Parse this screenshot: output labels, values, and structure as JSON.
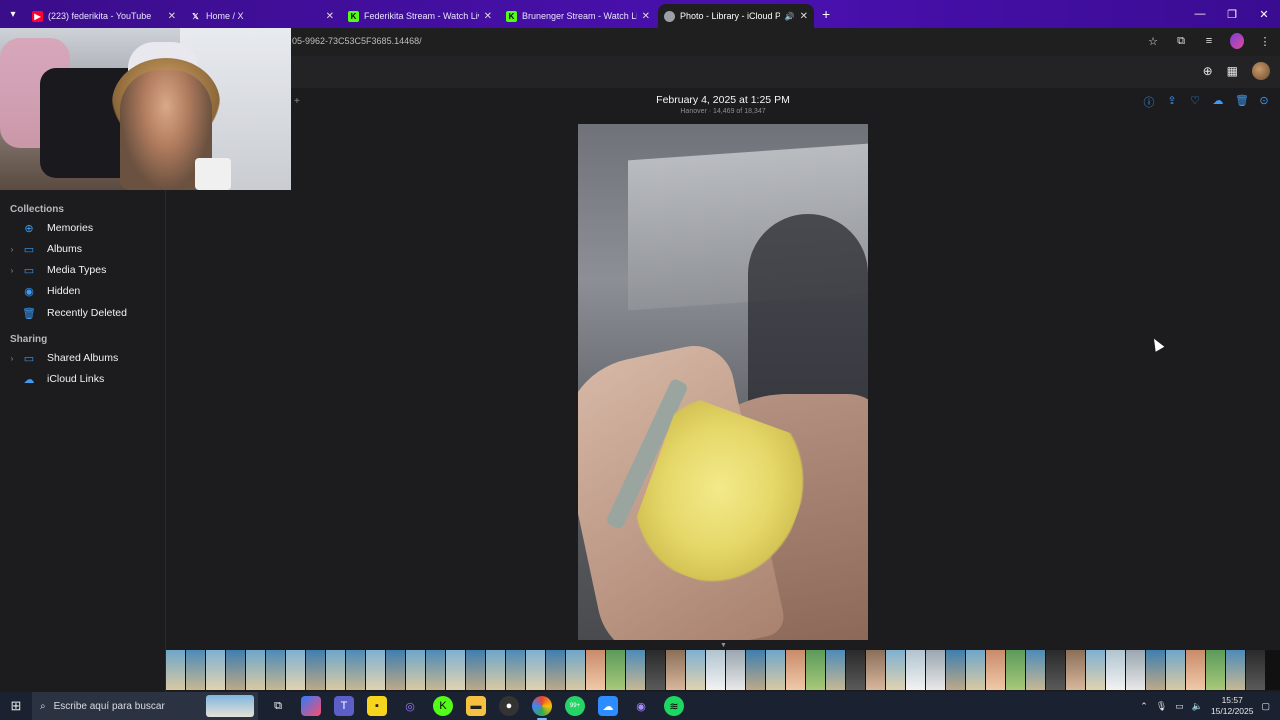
{
  "browser": {
    "tabs": [
      {
        "title": "(223) federikita - YouTube",
        "favicon": "youtube-icon",
        "color": "#ff0033",
        "active": false
      },
      {
        "title": "Home / X",
        "favicon": "x-icon",
        "color": "#ffffff",
        "active": false
      },
      {
        "title": "Federikita Stream - Watch Live",
        "favicon": "kick-icon",
        "color": "#53fc18",
        "active": false
      },
      {
        "title": "Brunenger Stream - Watch Live",
        "favicon": "kick-icon",
        "color": "#53fc18",
        "active": false
      },
      {
        "title": "Photo - Library - iCloud Ph",
        "favicon": "icloud-icon",
        "color": "#9aa0a6",
        "active": true
      }
    ],
    "url": "05-9962-73C53C5F3685.14468/"
  },
  "sidebar": {
    "collections_title": "Collections",
    "collections": [
      {
        "label": "Memories",
        "icon": "memories-icon",
        "glyph": "⊕",
        "expandable": false
      },
      {
        "label": "Albums",
        "icon": "albums-icon",
        "glyph": "▭",
        "expandable": true
      },
      {
        "label": "Media Types",
        "icon": "media-types-icon",
        "glyph": "▭",
        "expandable": true
      },
      {
        "label": "Hidden",
        "icon": "hidden-eye-icon",
        "glyph": "◉",
        "expandable": false
      },
      {
        "label": "Recently Deleted",
        "icon": "trash-icon",
        "glyph": "🗑",
        "expandable": false
      }
    ],
    "sharing_title": "Sharing",
    "sharing": [
      {
        "label": "Shared Albums",
        "icon": "shared-albums-icon",
        "glyph": "▭",
        "expandable": true
      },
      {
        "label": "iCloud Links",
        "icon": "cloud-link-icon",
        "glyph": "☁",
        "expandable": false
      }
    ]
  },
  "viewer": {
    "title": "February 4, 2025 at 1:25 PM",
    "subtitle": "Hanover · 14,469 of 18,347",
    "tools": [
      "info-icon",
      "share-icon",
      "favorite-heart-icon",
      "download-icon",
      "delete-icon",
      "more-icon"
    ]
  },
  "taskbar": {
    "search_placeholder": "Escribe aquí para buscar",
    "badge": "99+",
    "time": "15:57",
    "date": "15/12/2025"
  },
  "accent": "#3b9cf6"
}
